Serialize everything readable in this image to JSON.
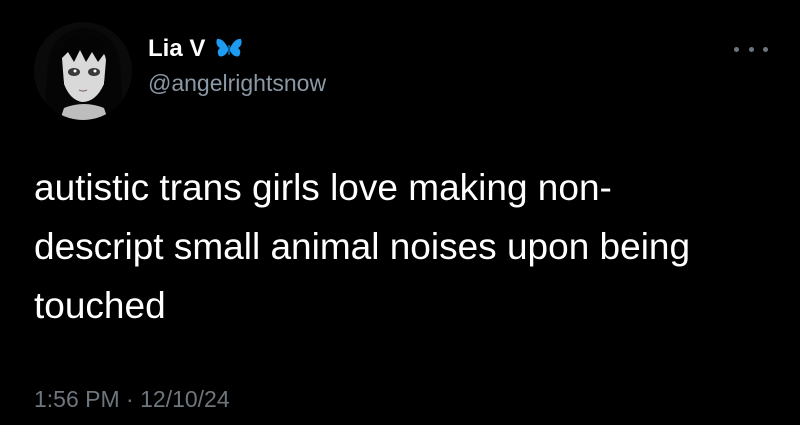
{
  "tweet": {
    "author": {
      "display_name": "Lia V",
      "badge_icon": "butterfly-icon",
      "badge_color": "#1d9bf0",
      "handle": "@angelrightsnow",
      "avatar_icon": "avatar-anime-girl"
    },
    "more_icon": "more-options-icon",
    "text": "autistic trans girls love making non-\ndescript small animal noises upon being\ntouched",
    "time": "1:56 PM",
    "separator": "·",
    "date": "12/10/24"
  },
  "colors": {
    "background": "#000000",
    "primary_text": "#ffffff",
    "secondary_text": "#6e767d",
    "accent": "#1d9bf0"
  }
}
